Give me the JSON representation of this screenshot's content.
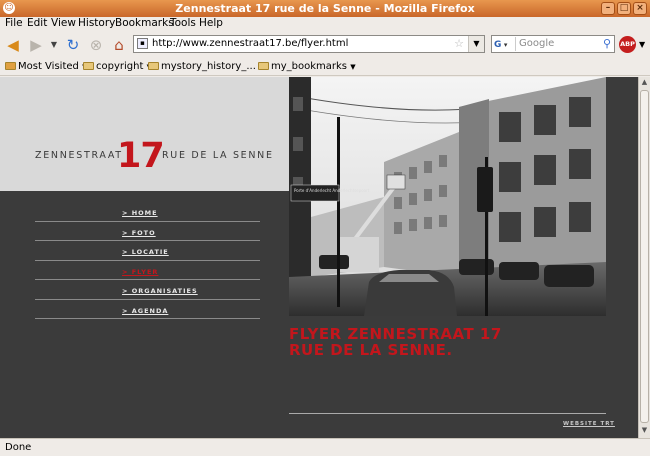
{
  "window": {
    "title": "Zennestraat 17 rue de la Senne - Mozilla Firefox"
  },
  "menu": [
    "File",
    "Edit",
    "View",
    "History",
    "Bookmarks",
    "Tools",
    "Help"
  ],
  "toolbar": {
    "url": "http://www.zennestraat17.be/flyer.html",
    "search_placeholder": "Google",
    "search_engine_glyph": "G",
    "abp_label": "ABP"
  },
  "bookmarks": [
    "Most Visited",
    "copyright",
    "mystory_history_...",
    "my_bookmarks"
  ],
  "site": {
    "logo_left": "ZENNESTRAAT",
    "logo_number": "17",
    "logo_right": "RUE DE LA SENNE",
    "nav": [
      "> HOME",
      "> FOTO",
      "> LOCATIE",
      "> FLYER",
      "> ORGANISATIES",
      "> AGENDA"
    ],
    "active_nav": "> FLYER",
    "heading_line1": "FLYER ZENNESTRAAT 17",
    "heading_line2": "RUE DE LA SENNE.",
    "credit": "WEBSITE  TRT",
    "photo_sign_text": "Porte d'Anderlecht Anderlechtsepoort"
  },
  "status": {
    "text": "Done"
  },
  "colors": {
    "accent_red": "#c3161c",
    "page_dark": "#3b3b3b",
    "header_grey": "#d9d9d9",
    "titlebar": "#d0743a"
  }
}
